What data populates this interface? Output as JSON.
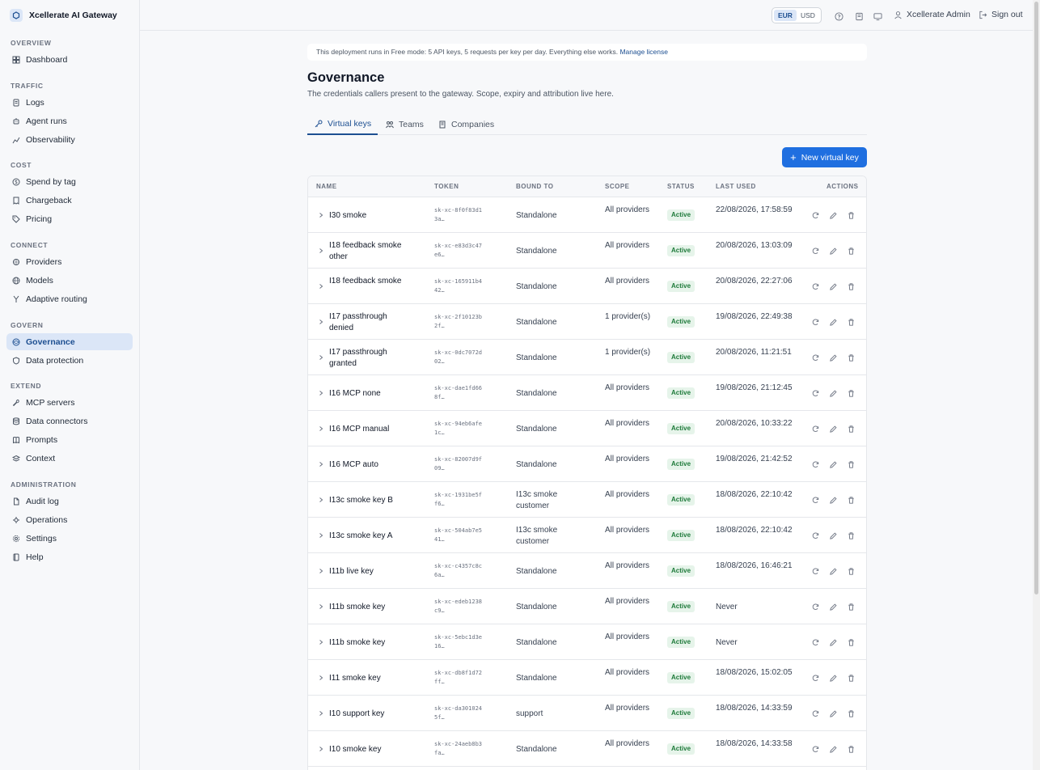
{
  "brand": {
    "title": "Xcellerate AI Gateway"
  },
  "sidebar": {
    "sections": [
      {
        "label": "OVERVIEW",
        "items": [
          {
            "label": "Dashboard",
            "icon": "dashboard-icon"
          }
        ]
      },
      {
        "label": "TRAFFIC",
        "items": [
          {
            "label": "Logs",
            "icon": "logs-icon"
          },
          {
            "label": "Agent runs",
            "icon": "agent-icon"
          },
          {
            "label": "Observability",
            "icon": "chart-icon"
          }
        ]
      },
      {
        "label": "COST",
        "items": [
          {
            "label": "Spend by tag",
            "icon": "coin-icon"
          },
          {
            "label": "Chargeback",
            "icon": "receipt-icon"
          },
          {
            "label": "Pricing",
            "icon": "tag-icon"
          }
        ]
      },
      {
        "label": "CONNECT",
        "items": [
          {
            "label": "Providers",
            "icon": "plug-icon"
          },
          {
            "label": "Models",
            "icon": "globe-icon"
          },
          {
            "label": "Adaptive routing",
            "icon": "routing-icon"
          }
        ]
      },
      {
        "label": "GOVERN",
        "items": [
          {
            "label": "Governance",
            "icon": "scale-icon",
            "active": true
          },
          {
            "label": "Data protection",
            "icon": "shield-icon"
          }
        ]
      },
      {
        "label": "EXTEND",
        "items": [
          {
            "label": "MCP servers",
            "icon": "wrench-icon"
          },
          {
            "label": "Data connectors",
            "icon": "database-icon"
          },
          {
            "label": "Prompts",
            "icon": "book-icon"
          },
          {
            "label": "Context",
            "icon": "layers-icon"
          }
        ]
      },
      {
        "label": "ADMINISTRATION",
        "items": [
          {
            "label": "Audit log",
            "icon": "file-icon"
          },
          {
            "label": "Operations",
            "icon": "operations-icon"
          },
          {
            "label": "Settings",
            "icon": "gear-icon"
          },
          {
            "label": "Help",
            "icon": "help-book-icon"
          }
        ]
      }
    ]
  },
  "topbar": {
    "currencies": [
      "EUR",
      "USD"
    ],
    "active_currency": "EUR",
    "user": "Xcellerate Admin",
    "signout": "Sign out"
  },
  "license": {
    "text": "This deployment runs in Free mode: 5 API keys, 5 requests per key per day. Everything else works.",
    "link": "Manage license"
  },
  "page": {
    "title": "Governance",
    "subtitle": "The credentials callers present to the gateway. Scope, expiry and attribution live here."
  },
  "tabs": [
    {
      "label": "Virtual keys",
      "icon": "key-icon",
      "active": true
    },
    {
      "label": "Teams",
      "icon": "team-icon"
    },
    {
      "label": "Companies",
      "icon": "building-icon"
    }
  ],
  "new_button": "New virtual key",
  "table": {
    "headers": {
      "name": "NAME",
      "token": "TOKEN",
      "bound": "BOUND TO",
      "scope": "SCOPE",
      "status": "STATUS",
      "last_used": "LAST USED",
      "actions": "ACTIONS"
    },
    "rows": [
      {
        "name": "I30 smoke",
        "token": "sk-xc-8f0f83d13a…",
        "bound": "Standalone",
        "scope": "All providers",
        "status": "Active",
        "last_used": "22/08/2026, 17:58:59"
      },
      {
        "name": "I18 feedback smoke other",
        "token": "sk-xc-e83d3c47e6…",
        "bound": "Standalone",
        "scope": "All providers",
        "status": "Active",
        "last_used": "20/08/2026, 13:03:09"
      },
      {
        "name": "I18 feedback smoke",
        "token": "sk-xc-165911b442…",
        "bound": "Standalone",
        "scope": "All providers",
        "status": "Active",
        "last_used": "20/08/2026, 22:27:06"
      },
      {
        "name": "I17 passthrough denied",
        "token": "sk-xc-2f10123b2f…",
        "bound": "Standalone",
        "scope": "1 provider(s)",
        "status": "Active",
        "last_used": "19/08/2026, 22:49:38"
      },
      {
        "name": "I17 passthrough granted",
        "token": "sk-xc-0dc7072d02…",
        "bound": "Standalone",
        "scope": "1 provider(s)",
        "status": "Active",
        "last_used": "20/08/2026, 11:21:51"
      },
      {
        "name": "I16 MCP none",
        "token": "sk-xc-dae1fd668f…",
        "bound": "Standalone",
        "scope": "All providers",
        "status": "Active",
        "last_used": "19/08/2026, 21:12:45"
      },
      {
        "name": "I16 MCP manual",
        "token": "sk-xc-94eb6afe1c…",
        "bound": "Standalone",
        "scope": "All providers",
        "status": "Active",
        "last_used": "20/08/2026, 10:33:22"
      },
      {
        "name": "I16 MCP auto",
        "token": "sk-xc-82007d9f09…",
        "bound": "Standalone",
        "scope": "All providers",
        "status": "Active",
        "last_used": "19/08/2026, 21:42:52"
      },
      {
        "name": "I13c smoke key B",
        "token": "sk-xc-1931be5ff6…",
        "bound": "I13c smoke customer",
        "scope": "All providers",
        "status": "Active",
        "last_used": "18/08/2026, 22:10:42"
      },
      {
        "name": "I13c smoke key A",
        "token": "sk-xc-504ab7e541…",
        "bound": "I13c smoke customer",
        "scope": "All providers",
        "status": "Active",
        "last_used": "18/08/2026, 22:10:42"
      },
      {
        "name": "I11b live key",
        "token": "sk-xc-c4357c8c6a…",
        "bound": "Standalone",
        "scope": "All providers",
        "status": "Active",
        "last_used": "18/08/2026, 16:46:21"
      },
      {
        "name": "I11b smoke key",
        "token": "sk-xc-edeb1238c9…",
        "bound": "Standalone",
        "scope": "All providers",
        "status": "Active",
        "last_used": "Never"
      },
      {
        "name": "I11b smoke key",
        "token": "sk-xc-5ebc1d3e16…",
        "bound": "Standalone",
        "scope": "All providers",
        "status": "Active",
        "last_used": "Never"
      },
      {
        "name": "I11 smoke key",
        "token": "sk-xc-db8f1d72ff…",
        "bound": "Standalone",
        "scope": "All providers",
        "status": "Active",
        "last_used": "18/08/2026, 15:02:05"
      },
      {
        "name": "I10 support key",
        "token": "sk-xc-da3010245f…",
        "bound": "support",
        "scope": "All providers",
        "status": "Active",
        "last_used": "18/08/2026, 14:33:59"
      },
      {
        "name": "I10 smoke key",
        "token": "sk-xc-24aeb8b3fa…",
        "bound": "Standalone",
        "scope": "All providers",
        "status": "Active",
        "last_used": "18/08/2026, 14:33:58"
      }
    ]
  },
  "colors": {
    "accent": "#1f6fe0",
    "active_nav_bg": "#dbe6f7",
    "status_green": "#1e7a3a"
  }
}
